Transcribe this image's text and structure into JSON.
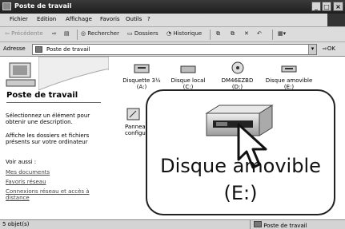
{
  "window": {
    "title": "Poste de travail",
    "minimize": "_",
    "maximize": "□",
    "close": "×"
  },
  "menu": [
    "Fichier",
    "Edition",
    "Affichage",
    "Favoris",
    "Outils",
    "?"
  ],
  "toolbar": {
    "back": "Précédente",
    "search": "Rechercher",
    "folders": "Dossiers",
    "history": "Historique"
  },
  "address": {
    "label": "Adresse",
    "value": "Poste de travail",
    "go": "OK"
  },
  "left_pane": {
    "title": "Poste de travail",
    "description": "Sélectionnez un élément pour obtenir une description.",
    "hint": "Affiche les dossiers et fichiers présents sur votre ordinateur",
    "see_also": "Voir aussi :",
    "links": [
      "Mes documents",
      "Favoris réseau",
      "Connexions réseau et accès à distance"
    ]
  },
  "main": {
    "drives": [
      {
        "label": "Disquette 3½ (A:)"
      },
      {
        "label": "Disque local (C:)"
      },
      {
        "label": "DM46EZBD (D:)"
      },
      {
        "label": "Disque amovible (E:)"
      }
    ],
    "panel": {
      "label": "Panneau de configuration"
    }
  },
  "popup": {
    "line1": "Disque amovible",
    "line2": "(E:)"
  },
  "status": {
    "left": "5 objet(s)",
    "right": "Poste de travail"
  }
}
